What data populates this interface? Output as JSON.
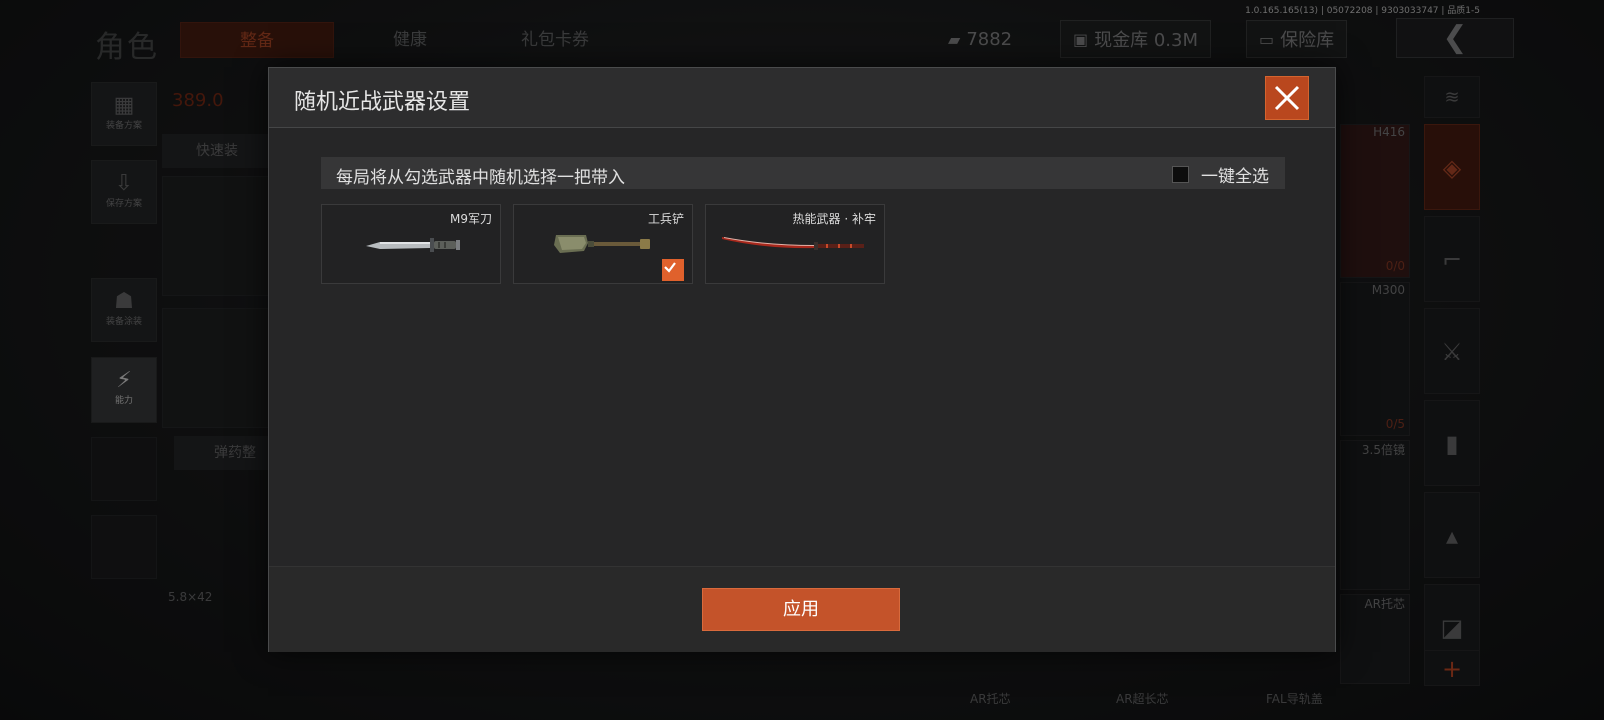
{
  "version_text": "1.0.165.165(13) | 05072208 | 9303033747 | 品质1-5",
  "background": {
    "page_title": "角色",
    "tabs": [
      {
        "label": "整备",
        "active": true
      },
      {
        "label": "健康",
        "active": false
      },
      {
        "label": "礼包卡券",
        "active": false
      }
    ],
    "currency_value": "7882",
    "cash_vault": "现金库 0.3M",
    "safe_box": "保险库",
    "left_menu": [
      {
        "label": "装备方案",
        "icon": "backpack-icon"
      },
      {
        "label": "保存方案",
        "icon": "download-icon"
      },
      {
        "label": "装备涂装",
        "icon": "helmet-icon"
      },
      {
        "label": "能力",
        "icon": "lightning-icon"
      }
    ],
    "weight": "389.0",
    "quick_equip": "快速装",
    "ammo_label": "弹药整",
    "caliber": "5.8×42",
    "right_slots": [
      {
        "name": "H416",
        "count": "0/0"
      },
      {
        "name": "M300",
        "count": "0/5"
      },
      {
        "name": "3.5倍镜",
        "count": ""
      },
      {
        "name": "AR托芯",
        "count": ""
      }
    ],
    "bottom_labels": [
      "AR托芯",
      "AR超长芯",
      "FAL导轨盖"
    ]
  },
  "modal": {
    "title": "随机近战武器设置",
    "hint": "每局将从勾选武器中随机选择一把带入",
    "select_all_label": "一键全选",
    "select_all_checked": false,
    "weapons": [
      {
        "name": "M9军刀",
        "checked": false,
        "icon": "knife-icon"
      },
      {
        "name": "工兵铲",
        "checked": true,
        "icon": "shovel-icon"
      },
      {
        "name": "热能武器 · 补牢",
        "checked": false,
        "icon": "katana-icon"
      }
    ],
    "apply_label": "应用"
  },
  "colors": {
    "accent": "#c4532a",
    "checkbox": "#e0612c",
    "close": "#b9471e"
  }
}
